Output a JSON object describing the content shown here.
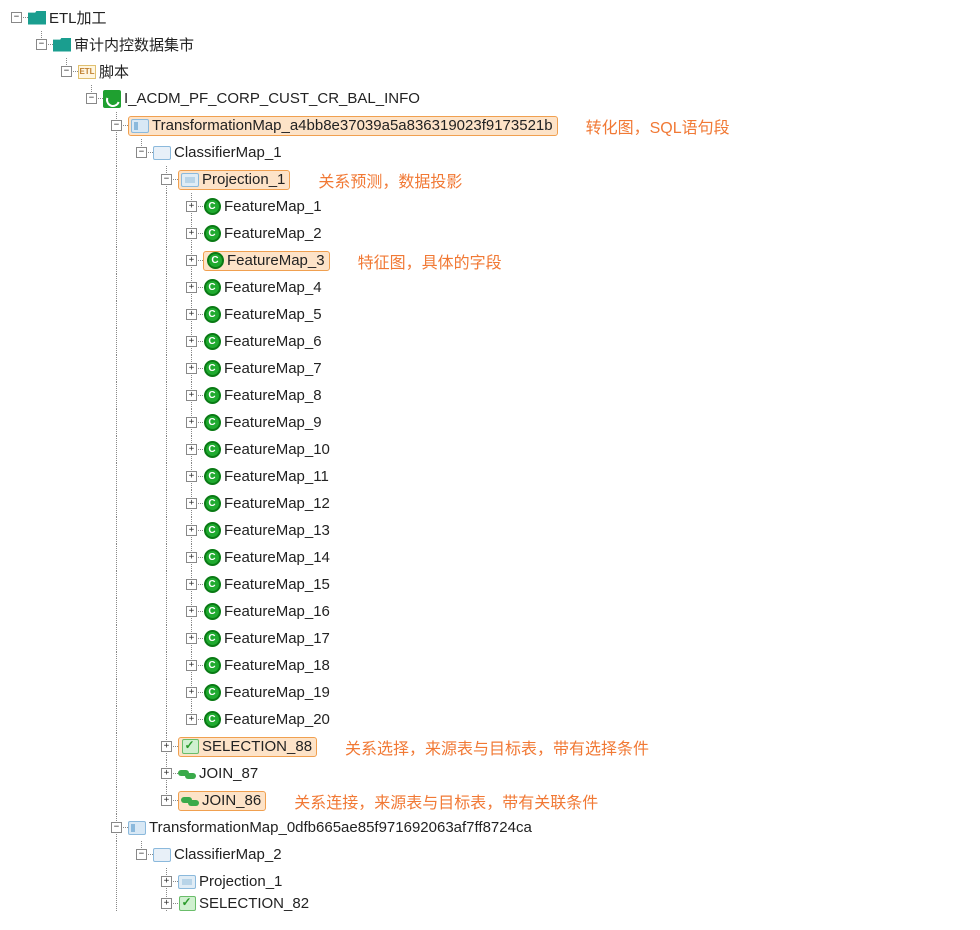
{
  "exp_minus": "−",
  "exp_plus": "+",
  "etl_label": "ETL",
  "feat_letter": "C",
  "root": {
    "label": "ETL加工"
  },
  "audit": {
    "label": "审计内控数据集市"
  },
  "script": {
    "label": "脚本"
  },
  "job": {
    "label": "I_ACDM_PF_CORP_CUST_CR_BAL_INFO"
  },
  "tmap1": {
    "label": "TransformationMap_a4bb8e37039a5a836319023f9173521b",
    "ann": "转化图，SQL语句段"
  },
  "class1": {
    "label": "ClassifierMap_1"
  },
  "proj1": {
    "label": "Projection_1",
    "ann": "关系预测，数据投影"
  },
  "feat": {
    "ann": "特征图，具体的字段",
    "items": [
      {
        "label": "FeatureMap_1"
      },
      {
        "label": "FeatureMap_2"
      },
      {
        "label": "FeatureMap_3"
      },
      {
        "label": "FeatureMap_4"
      },
      {
        "label": "FeatureMap_5"
      },
      {
        "label": "FeatureMap_6"
      },
      {
        "label": "FeatureMap_7"
      },
      {
        "label": "FeatureMap_8"
      },
      {
        "label": "FeatureMap_9"
      },
      {
        "label": "FeatureMap_10"
      },
      {
        "label": "FeatureMap_11"
      },
      {
        "label": "FeatureMap_12"
      },
      {
        "label": "FeatureMap_13"
      },
      {
        "label": "FeatureMap_14"
      },
      {
        "label": "FeatureMap_15"
      },
      {
        "label": "FeatureMap_16"
      },
      {
        "label": "FeatureMap_17"
      },
      {
        "label": "FeatureMap_18"
      },
      {
        "label": "FeatureMap_19"
      },
      {
        "label": "FeatureMap_20"
      }
    ]
  },
  "sel88": {
    "label": "SELECTION_88",
    "ann": "关系选择，来源表与目标表，带有选择条件"
  },
  "join87": {
    "label": "JOIN_87"
  },
  "join86": {
    "label": "JOIN_86",
    "ann": "关系连接，来源表与目标表，带有关联条件"
  },
  "tmap2": {
    "label": "TransformationMap_0dfb665ae85f971692063af7ff8724ca"
  },
  "class2": {
    "label": "ClassifierMap_2"
  },
  "proj2": {
    "label": "Projection_1"
  },
  "sel82": {
    "label": "SELECTION_82"
  }
}
